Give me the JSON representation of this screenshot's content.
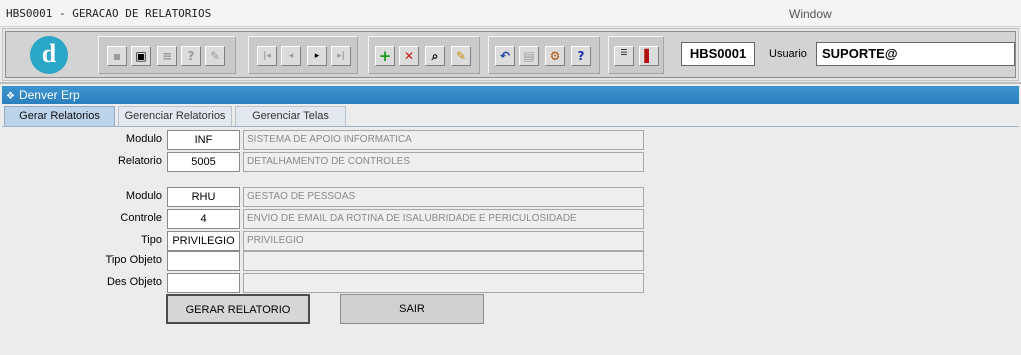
{
  "window": {
    "title": "HBS0001 - GERACAO DE RELATORIOS",
    "menu": "Window"
  },
  "toolbar": {
    "logo_letter": "d",
    "screen_code": "HBS0001",
    "user_label": "Usuario",
    "user_value": "SUPORTE@",
    "icons": [
      "save-icon",
      "window-icon",
      "print-icon",
      "help-query-icon",
      "edit-icon",
      "first-record-icon",
      "previous-record-icon",
      "next-record-icon",
      "last-record-icon",
      "add-record-icon",
      "delete-record-icon",
      "search-icon",
      "clear-icon",
      "undo-icon",
      "clipboard-icon",
      "tools-icon",
      "help-icon",
      "menu-icon",
      "exit-door-icon"
    ]
  },
  "form": {
    "header": "Denver Erp",
    "tabs": [
      "Gerar Relatorios",
      "Gerenciar Relatorios",
      "Gerenciar Telas"
    ],
    "fields": {
      "modulo1": {
        "label": "Modulo",
        "code": "INF",
        "desc": "SISTEMA DE APOIO INFORMATICA"
      },
      "relatorio": {
        "label": "Relatorio",
        "code": "5005",
        "desc": "DETALHAMENTO DE CONTROLES"
      },
      "modulo2": {
        "label": "Modulo",
        "code": "RHU",
        "desc": "GESTAO DE PESSOAS"
      },
      "controle": {
        "label": "Controle",
        "code": "4",
        "desc": "ENVIO DE EMAIL DA ROTINA DE ISALUBRIDADE E PERICULOSIDADE"
      },
      "tipo": {
        "label": "Tipo",
        "code": "PRIVILEGIO",
        "desc": "PRIVILEGIO"
      },
      "tipo_objeto": {
        "label": "Tipo Objeto",
        "code": "",
        "desc": ""
      },
      "des_objeto": {
        "label": "Des Objeto",
        "code": "",
        "desc": ""
      }
    },
    "buttons": {
      "gerar": "GERAR RELATORIO",
      "sair": "SAIR"
    }
  },
  "colors": {
    "header_blue": "#2a7fbc",
    "active_tab": "#bcd3ea"
  }
}
